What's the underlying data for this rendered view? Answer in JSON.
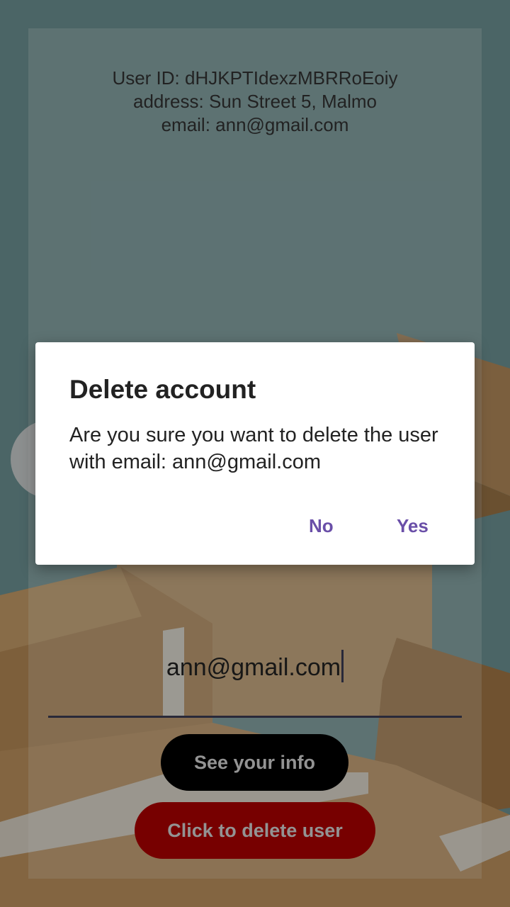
{
  "profile": {
    "user_id_line": "User ID: dHJKPTIdexzMBRRoEoiy",
    "address_line": "address: Sun Street 5, Malmo",
    "email_line": "email: ann@gmail.com"
  },
  "form": {
    "email_value": "ann@gmail.com",
    "see_info_label": "See your info",
    "delete_label": "Click to delete user"
  },
  "dialog": {
    "title": "Delete account",
    "message": "Are you sure you want to delete the user with email: ann@gmail.com",
    "no_label": "No",
    "yes_label": "Yes"
  },
  "colors": {
    "background": "#6f9597",
    "see_info_button": "#000000",
    "delete_button": "#b00000",
    "dialog_action": "#6a4fa8"
  },
  "icons": {
    "background": "cardboard-boxes-illustration"
  }
}
